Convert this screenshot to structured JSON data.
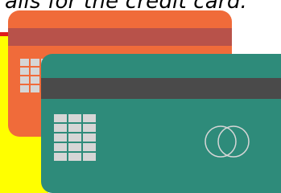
{
  "caption": {
    "text": "ails for the credit card."
  },
  "colors": {
    "yellow_panel": "#ffff00",
    "accent_red": "#e01b1b",
    "back_card": "#f06b3a",
    "back_card_stripe": "#b8524a",
    "front_card": "#2e8b7a",
    "front_card_stripe": "#4a4a4a",
    "chip": "#d6d6d6"
  },
  "icons": {
    "chip": "chip-icon",
    "brand": "card-brand-logo-icon"
  }
}
